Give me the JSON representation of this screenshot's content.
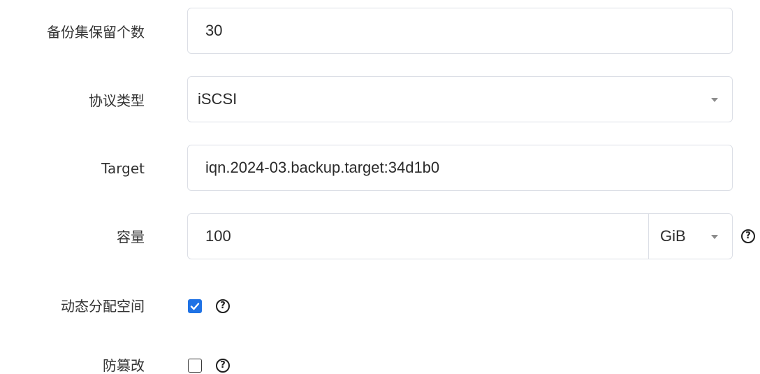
{
  "form": {
    "retention": {
      "label": "备份集保留个数",
      "value": "30"
    },
    "protocol": {
      "label": "协议类型",
      "selected": "iSCSI"
    },
    "target": {
      "label": "Target",
      "value": "iqn.2024-03.backup.target:34d1b0"
    },
    "capacity": {
      "label": "容量",
      "value": "100",
      "unit": "GiB"
    },
    "thin_provisioning": {
      "label": "动态分配空间",
      "checked": true
    },
    "tamper_proof": {
      "label": "防篡改",
      "checked": false
    }
  },
  "icons": {
    "help": "question-circle-icon",
    "dropdown": "caret-down-icon",
    "check": "check-icon"
  },
  "colors": {
    "accent": "#1f72e5",
    "border": "#dcdfe6",
    "text": "#333333"
  }
}
